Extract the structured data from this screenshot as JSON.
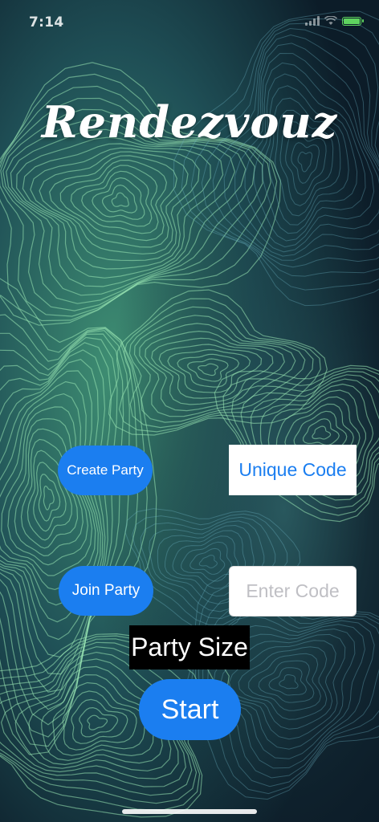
{
  "status_bar": {
    "time": "7:14",
    "battery_color": "#5fd35f"
  },
  "app": {
    "title": "Rendezvouz"
  },
  "create_party": {
    "label": "Create Party"
  },
  "unique_code": {
    "label": "Unique Code"
  },
  "join_party": {
    "label": "Join Party"
  },
  "enter_code": {
    "placeholder": "Enter Code",
    "value": ""
  },
  "party_size": {
    "label": "Party Size"
  },
  "start": {
    "label": "Start"
  },
  "colors": {
    "button_blue": "#1b7ef0",
    "background": "#0d1f2b",
    "contour_green": "#7fd9a0"
  }
}
